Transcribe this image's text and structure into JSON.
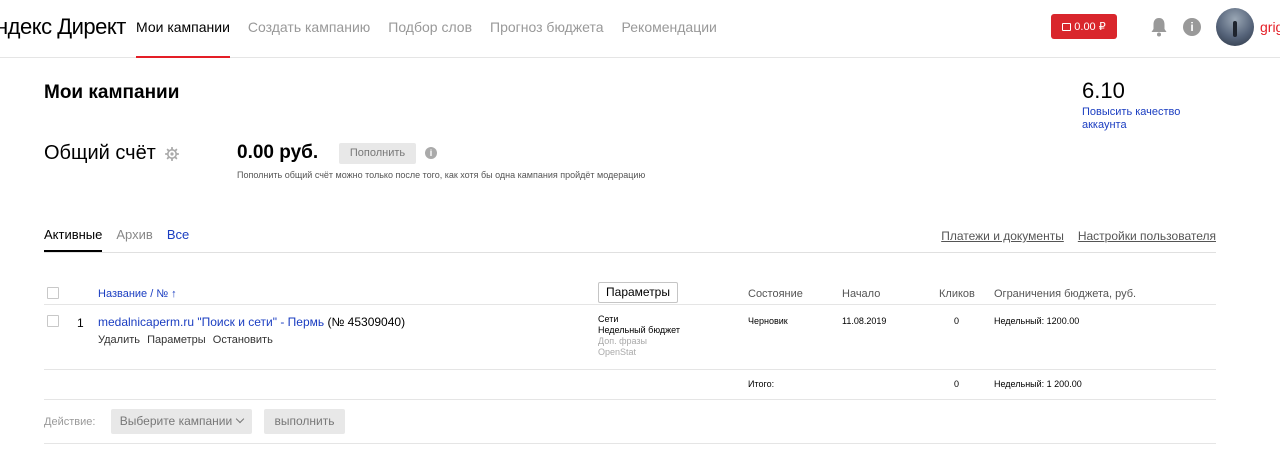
{
  "header": {
    "logo": "ндекс Директ",
    "nav": [
      {
        "label": "Мои кампании",
        "active": true
      },
      {
        "label": "Создать кампанию",
        "active": false
      },
      {
        "label": "Подбор слов",
        "active": false
      },
      {
        "label": "Прогноз бюджета",
        "active": false
      },
      {
        "label": "Рекомендации",
        "active": false
      }
    ],
    "balance": "0.00 ₽",
    "username": "grig"
  },
  "page": {
    "title": "Мои кампании",
    "quality_score": "6.10",
    "quality_link": "Повысить качество аккаунта"
  },
  "account": {
    "title": "Общий счёт",
    "amount": "0.00 руб.",
    "topup_label": "Пополнить",
    "note": "Пополнить общий счёт можно только после того, как хотя бы одна кампания пройдёт модерацию"
  },
  "filters": {
    "tabs": [
      {
        "label": "Активные",
        "state": "active"
      },
      {
        "label": "Архив",
        "state": "inactive"
      },
      {
        "label": "Все",
        "state": "link"
      }
    ],
    "links": [
      "Платежи и документы",
      "Настройки пользователя"
    ]
  },
  "table": {
    "headers": {
      "name": "Название / № ↑",
      "params_button": "Параметры",
      "status": "Состояние",
      "start": "Начало",
      "clicks": "Кликов",
      "budget": "Ограничения бюджета, руб."
    },
    "rows": [
      {
        "num": "1",
        "name_link": "medalnicaperm.ru \"Поиск и сети\" - Пермь",
        "name_suffix": " (№ 45309040)",
        "actions": [
          "Удалить",
          "Параметры",
          "Остановить"
        ],
        "details": [
          "Сети",
          "Недельный бюджет"
        ],
        "details_muted": [
          "Доп. фразы",
          "OpenStat"
        ],
        "status": "Черновик",
        "start": "11.08.2019",
        "clicks": "0",
        "budget": "Недельный: 1200.00"
      }
    ],
    "total": {
      "label": "Итого:",
      "clicks": "0",
      "budget": "Недельный: 1 200.00"
    }
  },
  "footer": {
    "action_label": "Действие:",
    "select_label": "Выберите кампании",
    "run_label": "выполнить"
  }
}
